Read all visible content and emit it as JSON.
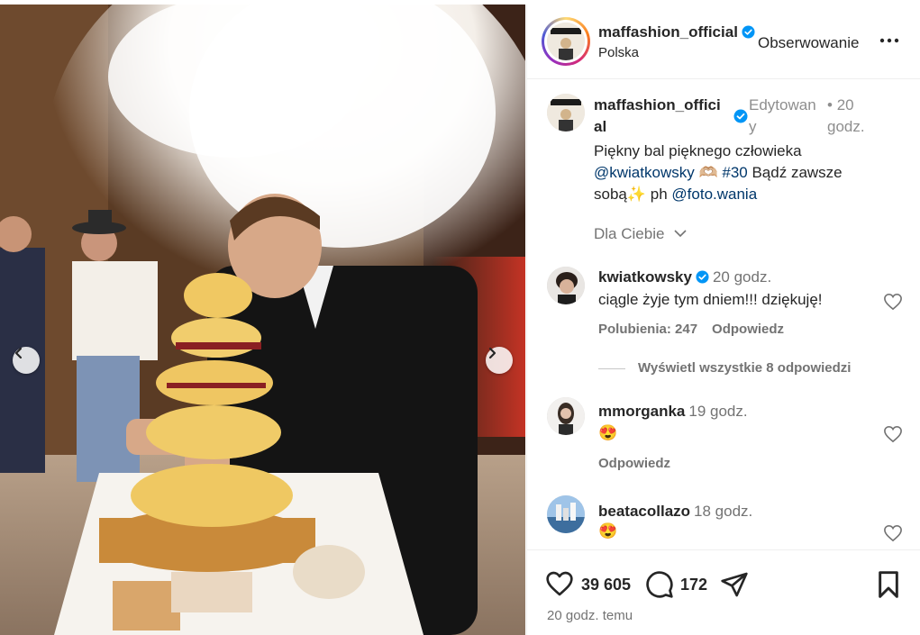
{
  "post": {
    "author": "maffashion_official",
    "location": "Polska",
    "follow_label": "Obserwowanie",
    "time_ago": "20 godz. temu"
  },
  "caption": {
    "author": "maffashion_official",
    "edited": "Edytowany",
    "dot": "•",
    "time": "20 godz.",
    "line1": "Piękny bal pięknego człowieka",
    "mention1": "@kwiatkowsky",
    "emoji1": "🫶🏼",
    "hashtag": "#30",
    "line2_rest": " Bądź zawsze",
    "line3_start": "sobą",
    "emoji2": "✨",
    "ph": " ph ",
    "mention2": "@foto.wania"
  },
  "sort_label": "Dla Ciebie",
  "comments": [
    {
      "user": "kwiatkowsky",
      "verified": true,
      "time": "20 godz.",
      "text": "ciągle żyje tym dniem!!! dziękuję!",
      "likes": "Polubienia: 247",
      "reply": "Odpowiedz"
    },
    {
      "user": "mmorganka",
      "verified": false,
      "time": "19 godz.",
      "text": "😍",
      "reply": "Odpowiedz"
    },
    {
      "user": "beatacollazo",
      "verified": false,
      "time": "18 godz.",
      "text": "😍"
    }
  ],
  "view_replies": "Wyświetl wszystkie 8 odpowiedzi",
  "actions": {
    "likes": "39 605",
    "comments": "172"
  },
  "colors": {
    "verified": "#0095f6",
    "link": "#00376b",
    "muted": "#737373"
  }
}
